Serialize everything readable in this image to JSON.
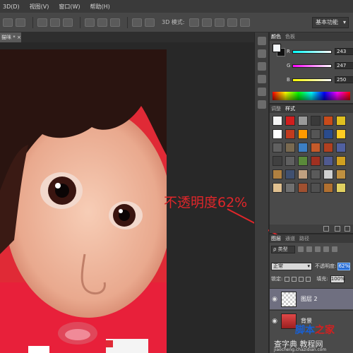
{
  "menu": [
    "3D(D)",
    "视图(V)",
    "窗口(W)",
    "帮助(H)"
  ],
  "options_bar": {
    "mode_3d_label": "3D 模式:",
    "workspace": "基本功能"
  },
  "document_tab": {
    "title": "猫咪 * ×"
  },
  "color_panel": {
    "tabs": [
      "颜色",
      "色板"
    ],
    "channels": [
      {
        "label": "R",
        "value": "243",
        "gradient": "#00ffff"
      },
      {
        "label": "G",
        "value": "247",
        "gradient": "#ff00ff"
      },
      {
        "label": "B",
        "value": "250",
        "gradient": "#ffff00"
      }
    ],
    "foreground": "#f3f7fa",
    "background": "#111111"
  },
  "styles_panel": {
    "tabs": [
      "调整",
      "样式"
    ],
    "swatches": [
      "#f5f5f5",
      "#d11e1e",
      "#9a9a9a",
      "#3a3a3a",
      "#c84b1a",
      "#e0c020",
      "#ffffff",
      "#c23b1e",
      "#ff9a00",
      "#555555",
      "#2a4b8c",
      "#ffcc22",
      "#606060",
      "#7a6a50",
      "#3c7fc4",
      "#c45a2a",
      "#b04020",
      "#5060a0",
      "#404040",
      "#606060",
      "#5a8a3a",
      "#a03020",
      "#505a90",
      "#d0a020",
      "#b08040",
      "#405070",
      "#c0a080",
      "#5a5a5a",
      "#d0d0d0",
      "#c09040",
      "#e0c090",
      "#707070",
      "#a05030",
      "#505050",
      "#b07030",
      "#e0d060"
    ]
  },
  "layers_panel": {
    "tabs": [
      "图层",
      "通道",
      "路径"
    ],
    "kind_filter": "ρ 类型",
    "blend_mode": "正常",
    "opacity_label": "不透明度:",
    "opacity_value": "62%",
    "lock_label": "锁定:",
    "fill_label": "填充:",
    "fill_value": "100%",
    "layers": [
      {
        "name": "图层 2",
        "selected": true
      },
      {
        "name": "背景",
        "selected": false
      }
    ]
  },
  "annotation": {
    "text": "不透明度62%",
    "color": "#e0262a"
  },
  "watermark": {
    "brand_a": "脚本",
    "brand_b": "之家",
    "sub": "查字典 教程网",
    "url": "jiaocheng.chazidian.com"
  }
}
